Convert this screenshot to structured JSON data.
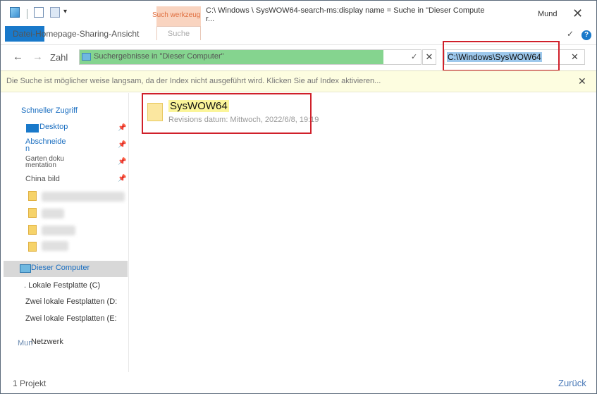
{
  "titlebar": {
    "title": "C:\\ Windows \\ SysWOW64-search-ms:display name = Suche in \"Dieser Compute r...",
    "search_tools_label": "Such werkzeug",
    "search_tab_label": "Suche",
    "ribbon_title": "Datei-Homepage-Sharing-Ansicht",
    "minimize_label": "Mund",
    "close_label": "✕",
    "qa_more": "▾",
    "ribbon_chevron": "✓",
    "help_label": "?"
  },
  "nav": {
    "back": "←",
    "forward": "→",
    "label": "Zahl",
    "address_text": "Suchergebnisse in \"Dieser Computer\"",
    "address_chevron": "✓",
    "address_clear": "✕",
    "search_value": "C:\\Windows\\SysWOW64",
    "search_clear": "✕"
  },
  "infobar": {
    "message": "Die Suche ist möglicher weise langsam, da der Index nicht ausgeführt wird. Klicken Sie auf Index aktivieren...",
    "close": "✕"
  },
  "sidebar": {
    "quick_access": "Schneller Zugriff",
    "desktop": "Desktop",
    "snip_line1": "Abschneide",
    "snip_line2": "n",
    "garden_line1": "Garten doku",
    "garden_line2": "mentation",
    "china": "China bild",
    "pin": "📌",
    "this_pc": "Dieser Computer",
    "drive_c": ". Lokale Festplatte (C)",
    "drive_d": "Zwei lokale Festplatten (D:",
    "drive_e": "Zwei lokale Festplatten (E:",
    "network_ghost": "Mun",
    "network": "Netzwerk"
  },
  "result": {
    "name": "SysWOW64",
    "subtitle": "Revisions datum: Mittwoch, 2022/6/8, 19:19"
  },
  "status": {
    "left": "1 Projekt",
    "right": "Zurück"
  },
  "colors": {
    "accent": "#1979ca",
    "highlight_red": "#d0202a",
    "address_progress": "#85d48f"
  }
}
